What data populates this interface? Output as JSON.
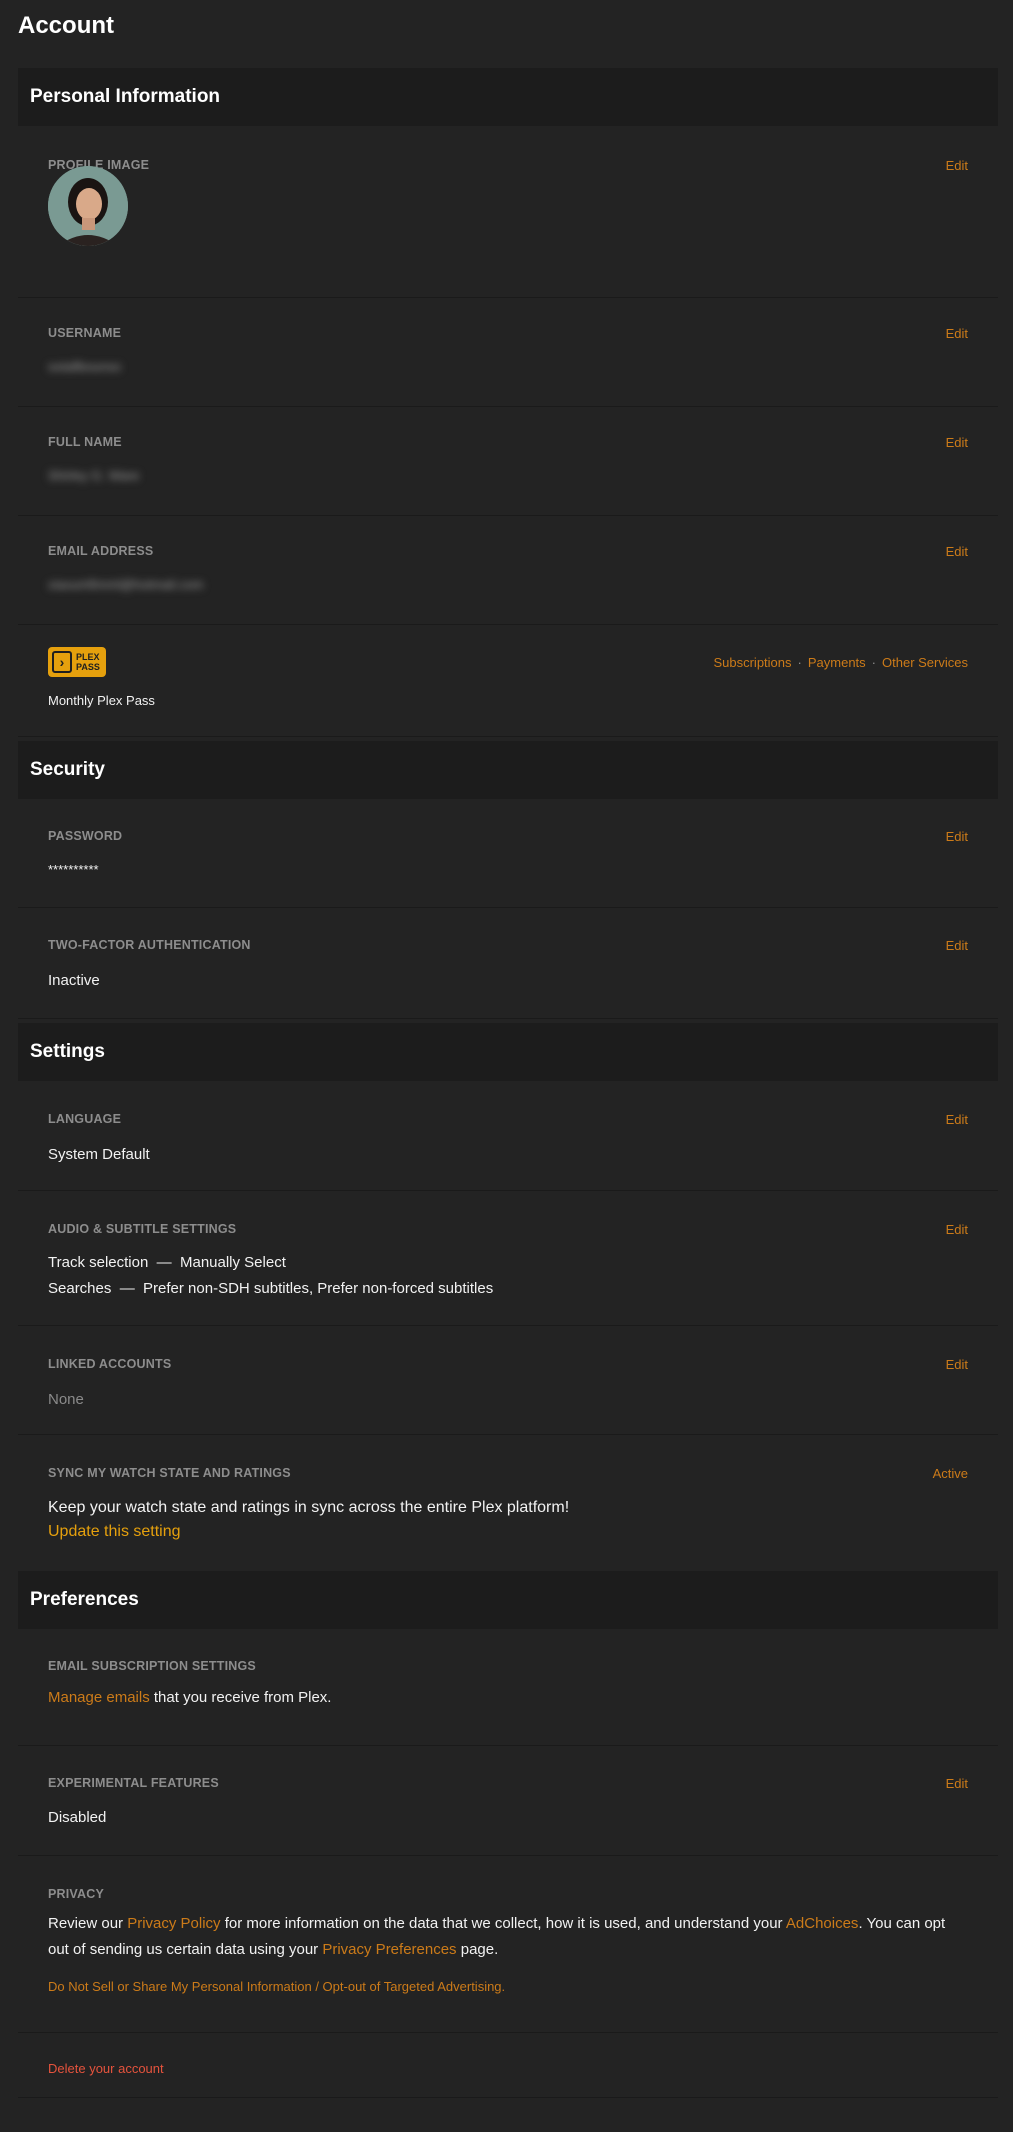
{
  "page": {
    "title": "Account"
  },
  "sections": {
    "personal": "Personal Information",
    "security": "Security",
    "settings": "Settings",
    "preferences": "Preferences"
  },
  "edit_label": "Edit",
  "profile_image": {
    "label": "PROFILE IMAGE"
  },
  "username": {
    "label": "USERNAME",
    "value": "sotallbounso"
  },
  "full_name": {
    "label": "FULL NAME",
    "value": "Shirley G. Ware"
  },
  "email": {
    "label": "EMAIL ADDRESS",
    "value": "xiaxumfimml@hotmail.com"
  },
  "plex_pass": {
    "badge_line1": "PLEX",
    "badge_line2": "PASS",
    "plan": "Monthly Plex Pass",
    "links": [
      "Subscriptions",
      "Payments",
      "Other Services"
    ],
    "separator": "·"
  },
  "password": {
    "label": "PASSWORD",
    "value": "**********"
  },
  "two_factor": {
    "label": "TWO-FACTOR AUTHENTICATION",
    "value": "Inactive"
  },
  "language": {
    "label": "LANGUAGE",
    "value": "System Default"
  },
  "audio_subtitle": {
    "label": "AUDIO & SUBTITLE SETTINGS",
    "line1": "Track selection  —  Manually Select",
    "line2": "Searches  —  Prefer non-SDH subtitles, Prefer non-forced subtitles"
  },
  "linked_accounts": {
    "label": "LINKED ACCOUNTS",
    "value": "None"
  },
  "sync_watch": {
    "label": "SYNC MY WATCH STATE AND RATINGS",
    "status": "Active",
    "description": "Keep your watch state and ratings in sync across the entire Plex platform!",
    "update_link": "Update this setting"
  },
  "email_subscription": {
    "label": "EMAIL SUBSCRIPTION SETTINGS",
    "link": "Manage emails",
    "text": " that you receive from Plex."
  },
  "experimental": {
    "label": "EXPERIMENTAL FEATURES",
    "value": "Disabled"
  },
  "privacy": {
    "label": "PRIVACY",
    "t1": "Review our ",
    "link1": "Privacy Policy",
    "t2": " for more information on the data that we collect, how it is used, and understand your ",
    "link2": "AdChoices",
    "t3": ". You can opt out of sending us certain data using your ",
    "link3": "Privacy Preferences",
    "t4": " page.",
    "opt_out": "Do Not Sell or Share My Personal Information / Opt-out of Targeted Advertising."
  },
  "delete_account": "Delete your account",
  "colors": {
    "accent": "#cc7b19",
    "plex_yellow": "#e5a00d",
    "danger": "#e5533d",
    "background": "#232323"
  }
}
